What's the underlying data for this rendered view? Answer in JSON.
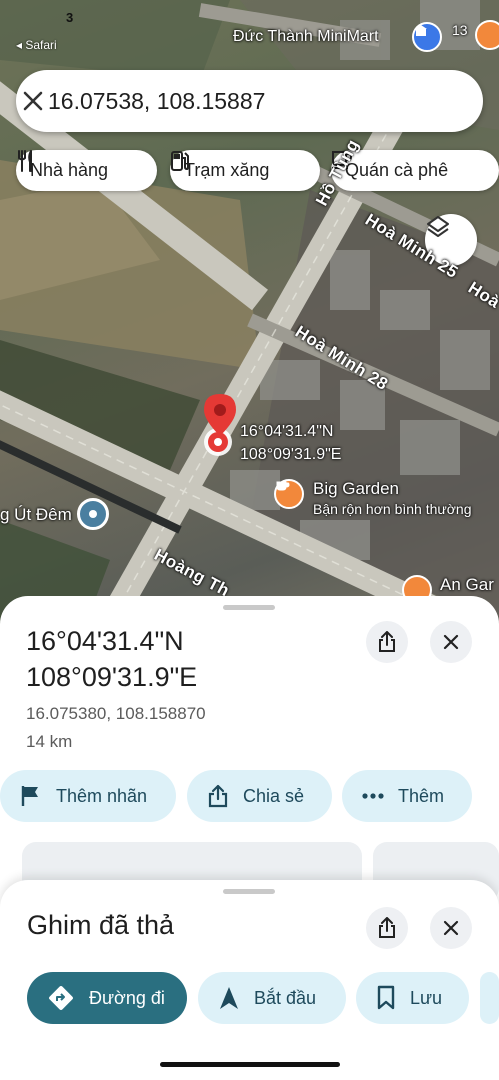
{
  "status": {
    "time": "3",
    "back_label": "◂ Safari"
  },
  "search": {
    "value": "16.07538, 108.15887"
  },
  "chips": [
    {
      "label": "Nhà hàng",
      "icon": "restaurant-icon"
    },
    {
      "label": "Trạm xăng",
      "icon": "gas-station-icon"
    },
    {
      "label": "Quán cà phê",
      "icon": "coffee-icon"
    }
  ],
  "map": {
    "top_place": "Đức Thành MiniMart",
    "roads": [
      "Hồ Tùng Mậu",
      "Hoà Minh 25",
      "Hoà Minh 28",
      "Hoàng Thị Loan"
    ],
    "road_labels": {
      "ho_tung_mau": "Hồ Tùng",
      "hoa_minh_25": "Hoà Minh 25",
      "hoa_minh_28": "Hoà Minh 28",
      "hoang_thi": "Hoàng Th",
      "hoa_right": "Hoà"
    },
    "pin_label_lat": "16°04'31.4\"N",
    "pin_label_lng": "108°09'31.9\"E",
    "poi_big_garden": {
      "name": "Big Garden",
      "tagline": "Bận rộn hơn bình thường"
    },
    "poi_left": "g Út Đêm",
    "poi_right": "An Gar",
    "badge_count": "13"
  },
  "sheet": {
    "lat_dms": "16°04'31.4\"N",
    "lng_dms": "108°09'31.9\"E",
    "decimal": "16.075380, 108.158870",
    "distance": "14 km",
    "actions": [
      {
        "label": "Thêm nhãn",
        "icon": "flag-icon"
      },
      {
        "label": "Chia sẻ",
        "icon": "share-icon"
      },
      {
        "label": "Thêm",
        "icon": "more-icon"
      }
    ]
  },
  "pin_sheet": {
    "title": "Ghim đã thả",
    "actions": [
      {
        "label": "Đường đi",
        "icon": "directions-icon"
      },
      {
        "label": "Bắt đầu",
        "icon": "navigation-icon"
      },
      {
        "label": "Lưu",
        "icon": "bookmark-icon"
      }
    ]
  },
  "colors": {
    "accent": "#2a6f80",
    "pill_bg": "#ddf1f8",
    "pin_red": "#e53935",
    "poi_orange": "#f2883b"
  }
}
